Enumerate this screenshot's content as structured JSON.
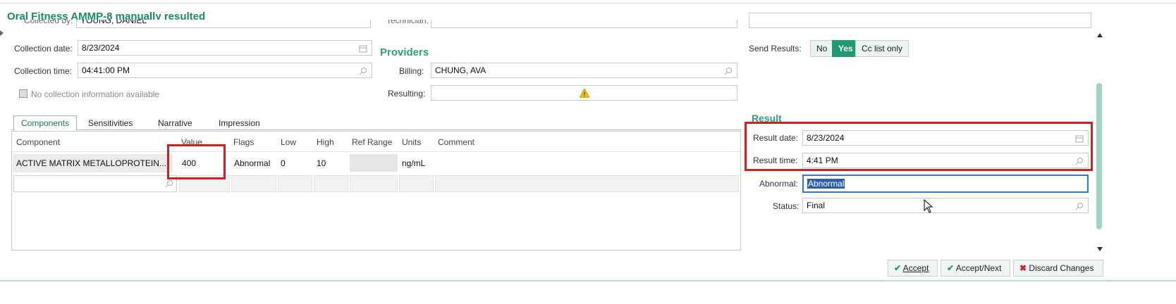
{
  "header": {
    "title": "Oral Fitness AMMP-8 manually resulted"
  },
  "collection": {
    "collected_by_label": "Collected by:",
    "collected_by_value": "YOUNG, DANIEL",
    "date_label": "Collection date:",
    "date_value": "8/23/2024",
    "time_label": "Collection time:",
    "time_value": "04:41:00 PM",
    "no_info_label": "No collection information available"
  },
  "providers": {
    "title": "Providers",
    "technician_label": "Technician:",
    "billing_label": "Billing:",
    "billing_value": "CHUNG, AVA",
    "resulting_label": "Resulting:"
  },
  "send_results": {
    "label": "Send Results:",
    "options": [
      "No",
      "Yes",
      "Cc list only"
    ],
    "selected": "Yes"
  },
  "tabs": [
    {
      "label": "Components",
      "active": true
    },
    {
      "label": "Sensitivities",
      "active": false
    },
    {
      "label": "Narrative",
      "active": false
    },
    {
      "label": "Impression",
      "active": false
    }
  ],
  "grid": {
    "headers": [
      "Component",
      "Value",
      "Flags",
      "Low",
      "High",
      "Ref Range",
      "Units",
      "Comment"
    ],
    "row": {
      "component": "ACTIVE MATRIX METALLOPROTEIN...",
      "value": "400",
      "flags": "Abnormal",
      "low": "0",
      "high": "10",
      "ref_range": "",
      "units": "ng/mL",
      "comment": ""
    }
  },
  "result": {
    "title": "Result",
    "date_label": "Result date:",
    "date_value": "8/23/2024",
    "time_label": "Result time:",
    "time_value": "4:41 PM",
    "abnormal_label": "Abnormal:",
    "abnormal_value": "Abnormal",
    "status_label": "Status:",
    "status_value": "Final"
  },
  "footer": {
    "accept": "Accept",
    "accept_next": "Accept/Next",
    "discard": "Discard Changes"
  },
  "colors": {
    "accent": "#1f9a72",
    "highlight": "#d21e1e",
    "warning": "#f2c200"
  }
}
